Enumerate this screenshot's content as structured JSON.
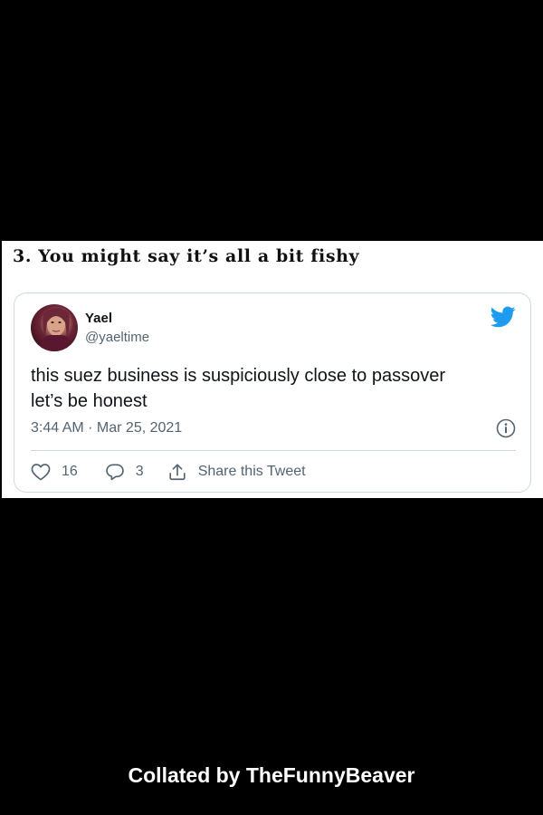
{
  "heading": "3. You might say it’s all a bit fishy",
  "tweet": {
    "display_name": "Yael",
    "handle": "@yaeltime",
    "text_line1": "this suez business is suspiciously close to passover",
    "text_line2": "let’s be honest",
    "timestamp": "3:44 AM · Mar 25, 2021",
    "likes": "16",
    "replies": "3",
    "share_label": "Share this Tweet",
    "icons": {
      "brand": "twitter-bird-icon",
      "info": "info-icon",
      "like": "heart-icon",
      "reply": "speech-bubble-icon",
      "share": "share-upload-icon"
    },
    "colors": {
      "brand": "#1d9bf0",
      "secondary_text": "#536471",
      "primary_text": "#0f1419"
    }
  },
  "footer": "Collated by TheFunnyBeaver"
}
